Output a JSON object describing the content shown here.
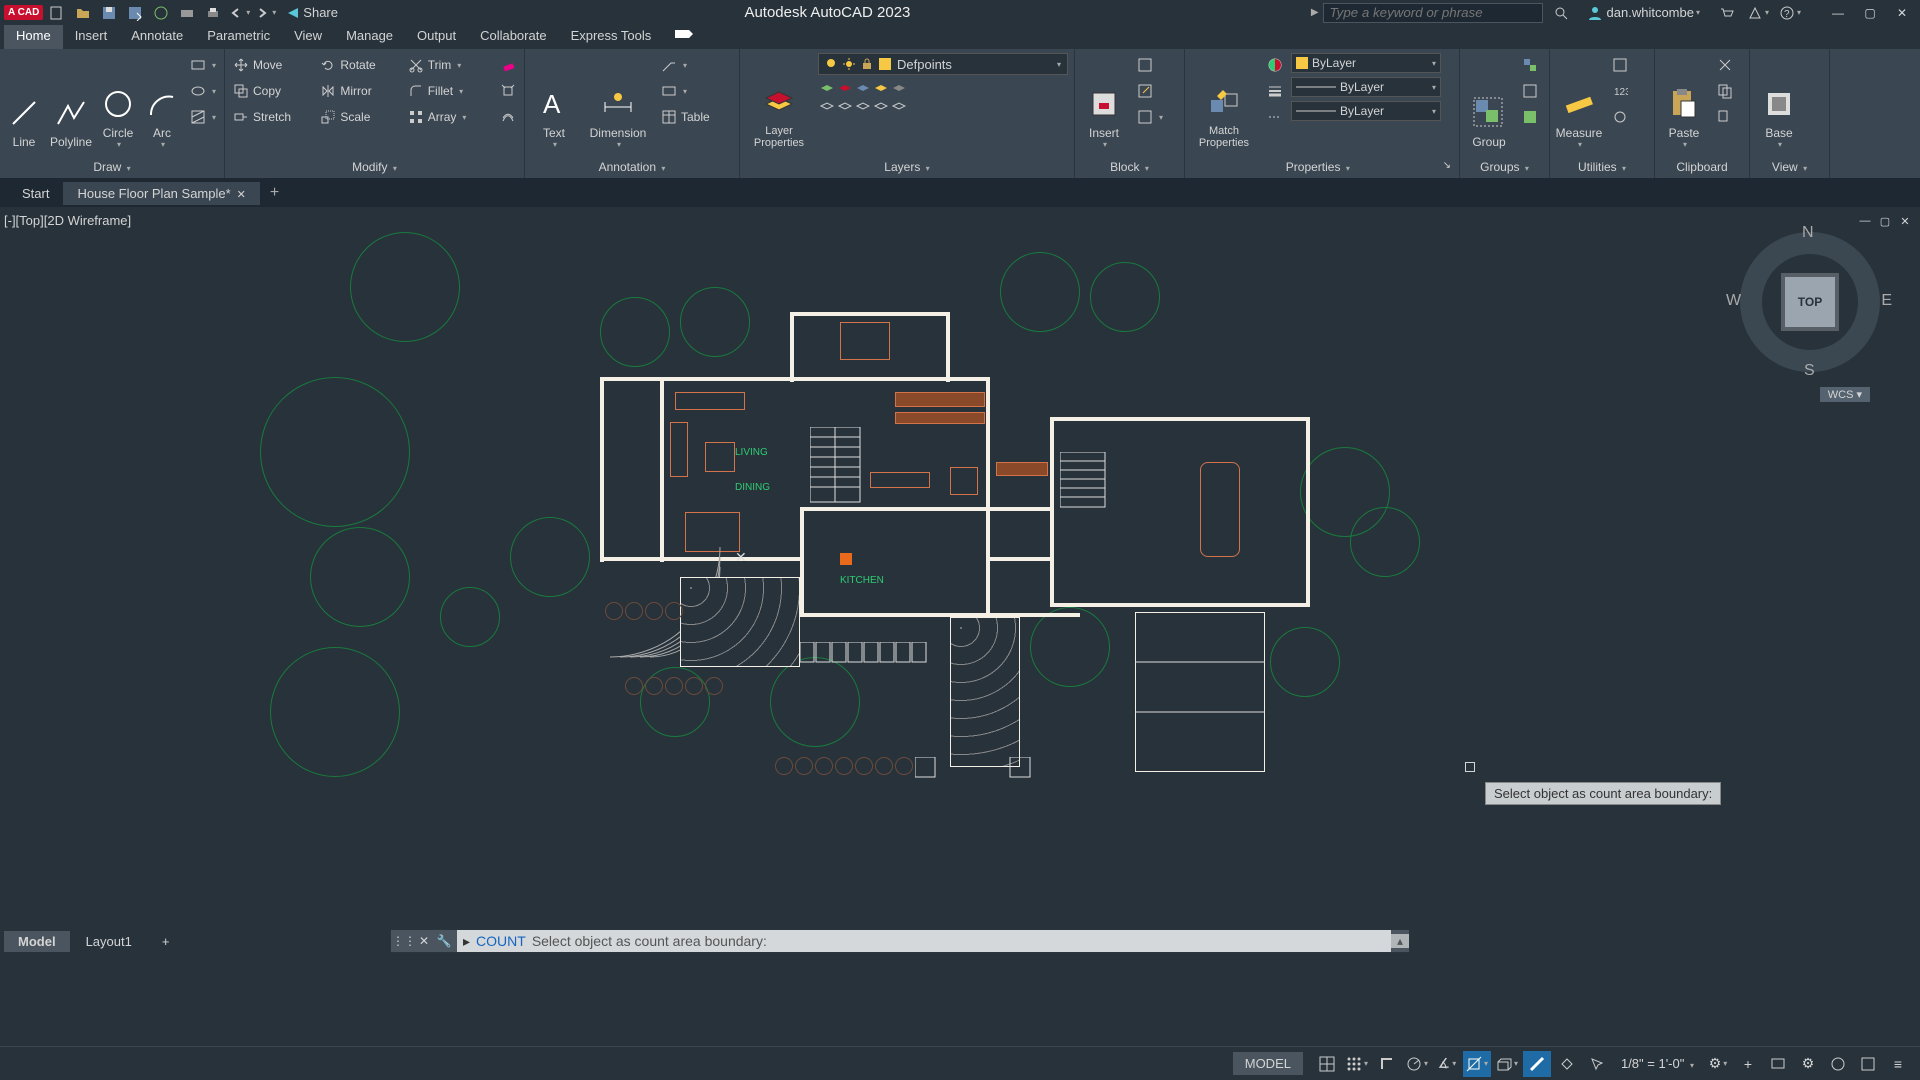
{
  "app": {
    "badge": "A CAD",
    "title": "Autodesk AutoCAD 2023",
    "share": "Share",
    "search_placeholder": "Type a keyword or phrase",
    "user": "dan.whitcombe",
    "window_controls": {
      "min": "—",
      "max": "▢",
      "close": "✕"
    }
  },
  "menubar": [
    "Home",
    "Insert",
    "Annotate",
    "Parametric",
    "View",
    "Manage",
    "Output",
    "Collaborate",
    "Express Tools"
  ],
  "active_menu": "Home",
  "ribbon": {
    "draw": {
      "title": "Draw",
      "line": "Line",
      "polyline": "Polyline",
      "circle": "Circle",
      "arc": "Arc"
    },
    "modify": {
      "title": "Modify",
      "move": "Move",
      "rotate": "Rotate",
      "trim": "Trim",
      "copy": "Copy",
      "mirror": "Mirror",
      "fillet": "Fillet",
      "stretch": "Stretch",
      "scale": "Scale",
      "array": "Array"
    },
    "annotation": {
      "title": "Annotation",
      "text": "Text",
      "dimension": "Dimension",
      "table": "Table"
    },
    "layers": {
      "title": "Layers",
      "layer_props": "Layer\nProperties",
      "current": "Defpoints"
    },
    "block": {
      "title": "Block",
      "insert": "Insert"
    },
    "properties": {
      "title": "Properties",
      "match": "Match\nProperties",
      "bylayer": "ByLayer"
    },
    "groups": {
      "title": "Groups",
      "group": "Group"
    },
    "utilities": {
      "title": "Utilities",
      "measure": "Measure"
    },
    "clipboard": {
      "title": "Clipboard",
      "paste": "Paste"
    },
    "view": {
      "title": "View",
      "base": "Base"
    }
  },
  "file_tabs": {
    "start": "Start",
    "doc": "House Floor Plan Sample*"
  },
  "viewport": {
    "label": "[-][Top][2D Wireframe]",
    "viewcube": {
      "face": "TOP",
      "n": "N",
      "s": "S",
      "e": "E",
      "w": "W",
      "wcs": "WCS"
    },
    "rooms": {
      "living": "LIVING",
      "dining": "DINING",
      "kitchen": "KITCHEN"
    },
    "tooltip": "Select object as count area boundary:"
  },
  "command": {
    "name": "COUNT",
    "prompt": "Select object as count area boundary:"
  },
  "layout_tabs": {
    "model": "Model",
    "l1": "Layout1",
    "add": "+"
  },
  "statusbar": {
    "model": "MODEL",
    "scale": "1/8\" = 1'-0\""
  }
}
